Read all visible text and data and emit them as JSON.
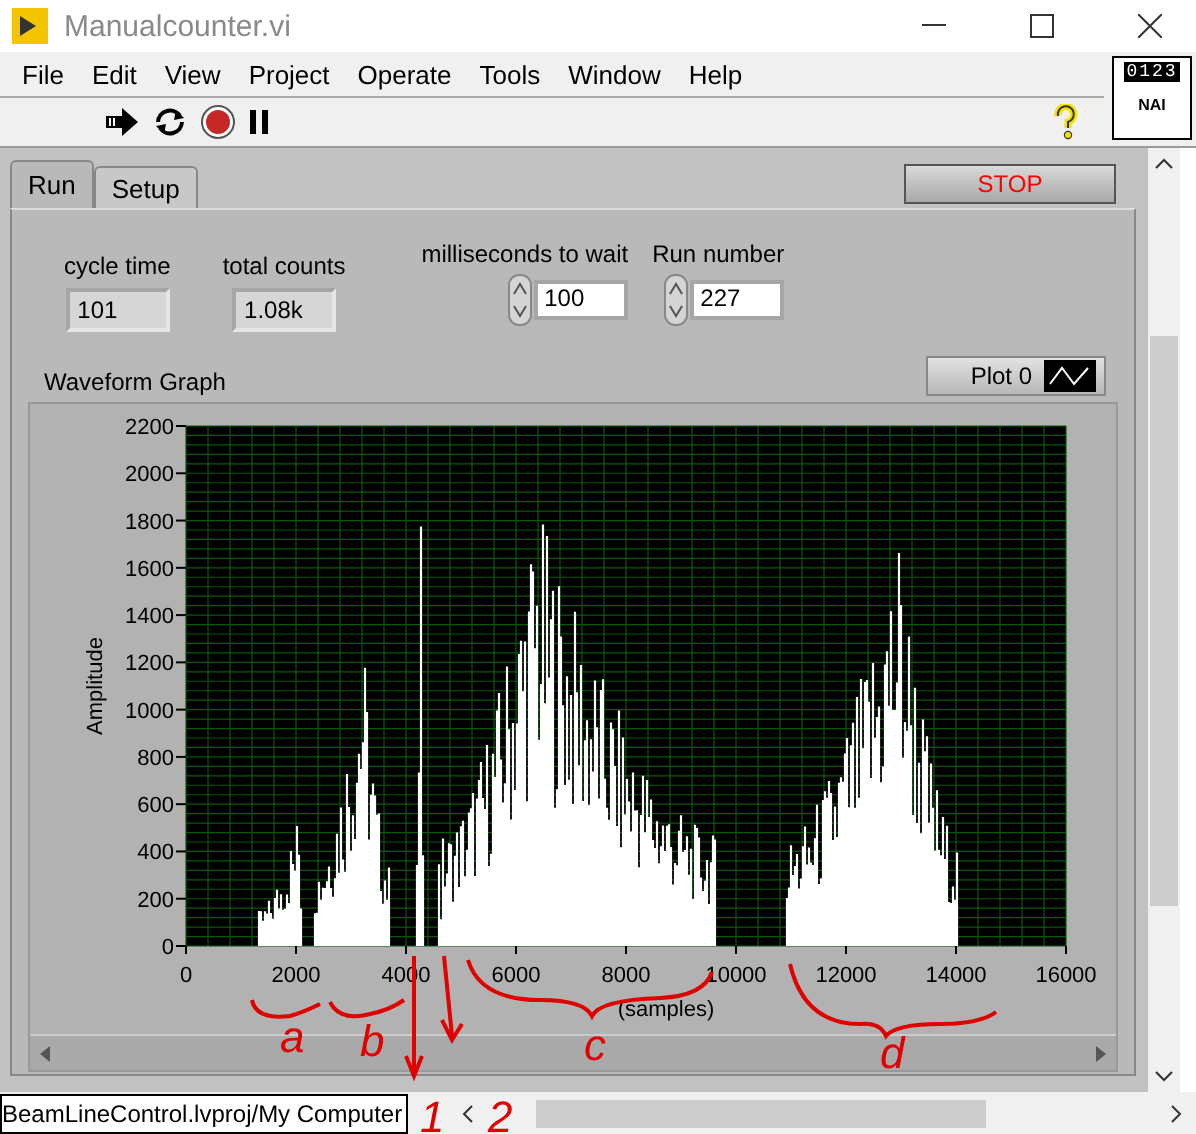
{
  "window": {
    "title": "Manualcounter.vi"
  },
  "menu": [
    "File",
    "Edit",
    "View",
    "Project",
    "Operate",
    "Tools",
    "Window",
    "Help"
  ],
  "connector_pane": {
    "digits": "0123",
    "label": "NAI"
  },
  "tabs": [
    {
      "label": "Run",
      "selected": true
    },
    {
      "label": "Setup",
      "selected": false
    }
  ],
  "stop_button": {
    "label": "STOP"
  },
  "indicators": [
    {
      "label": "cycle time",
      "value": "101"
    },
    {
      "label": "total counts",
      "value": "1.08k"
    }
  ],
  "controls": [
    {
      "label": "milliseconds to wait",
      "value": "100"
    },
    {
      "label": "Run number",
      "value": "227"
    }
  ],
  "graph": {
    "title": "Waveform Graph",
    "legend": "Plot 0",
    "ylabel": "Amplitude",
    "xlabel": "(samples)",
    "xticks": [
      "0",
      "2000",
      "4000",
      "6000",
      "8000",
      "10000",
      "12000",
      "14000",
      "16000"
    ],
    "yticks": [
      "2200",
      "2000",
      "1800",
      "1600",
      "1400",
      "1200",
      "1000",
      "800",
      "600",
      "400",
      "200",
      "0"
    ]
  },
  "status_bar": {
    "path": "BeamLineControl.lvproj/My Computer"
  },
  "annotations": [
    {
      "text": "a"
    },
    {
      "text": "b"
    },
    {
      "text": "c"
    },
    {
      "text": "d"
    },
    {
      "text": "1"
    },
    {
      "text": "2"
    }
  ]
}
